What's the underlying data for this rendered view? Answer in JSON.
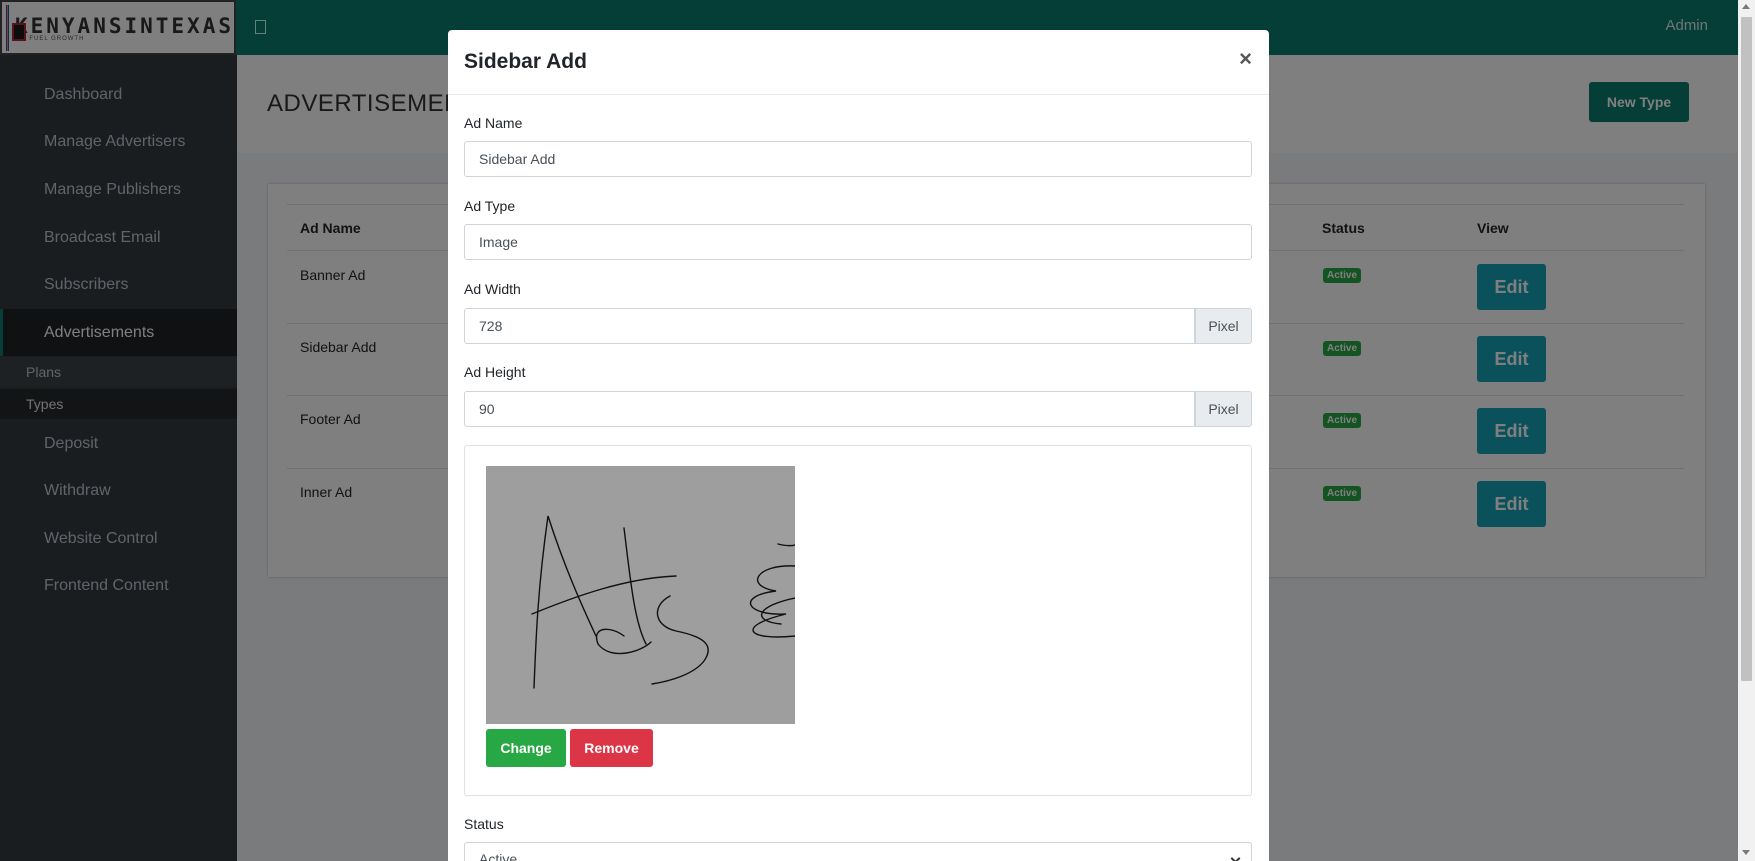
{
  "brand": {
    "name": "KENYANSINTEXAS",
    "tagline": "WE FUEL GROWTH"
  },
  "topbar": {
    "user": "Admin"
  },
  "sidebar": {
    "items": [
      {
        "label": "Dashboard"
      },
      {
        "label": "Manage Advertisers"
      },
      {
        "label": "Manage Publishers"
      },
      {
        "label": "Broadcast Email"
      },
      {
        "label": "Subscribers"
      },
      {
        "label": "Advertisements"
      },
      {
        "label": "Deposit"
      },
      {
        "label": "Withdraw"
      },
      {
        "label": "Website Control"
      },
      {
        "label": "Frontend Content"
      }
    ],
    "subitems": [
      {
        "label": "Plans"
      },
      {
        "label": "Types"
      }
    ]
  },
  "page": {
    "title": "ADVERTISEMENT",
    "new_type_label": "New Type"
  },
  "table": {
    "headers": [
      "Ad Name",
      "Status",
      "View"
    ],
    "rows": [
      {
        "name": "Banner Ad",
        "status": "Active",
        "action": "Edit"
      },
      {
        "name": "Sidebar Add",
        "status": "Active",
        "action": "Edit"
      },
      {
        "name": "Footer Ad",
        "status": "Active",
        "action": "Edit"
      },
      {
        "name": "Inner Ad",
        "status": "Active",
        "action": "Edit"
      }
    ]
  },
  "modal": {
    "title": "Sidebar Add",
    "close": "×",
    "fields": {
      "name_label": "Ad Name",
      "name_value": "Sidebar Add",
      "type_label": "Ad Type",
      "type_value": "Image",
      "width_label": "Ad Width",
      "width_value": "728",
      "width_unit": "Pixel",
      "height_label": "Ad Height",
      "height_value": "90",
      "height_unit": "Pixel"
    },
    "buttons": {
      "change": "Change",
      "remove": "Remove"
    },
    "status_label": "Status",
    "status_value": "Active"
  },
  "colors": {
    "accent": "#0b7a6e",
    "sidebar": "#343a40",
    "info": "#17a2b8",
    "success": "#28a745",
    "danger": "#dc3545"
  }
}
